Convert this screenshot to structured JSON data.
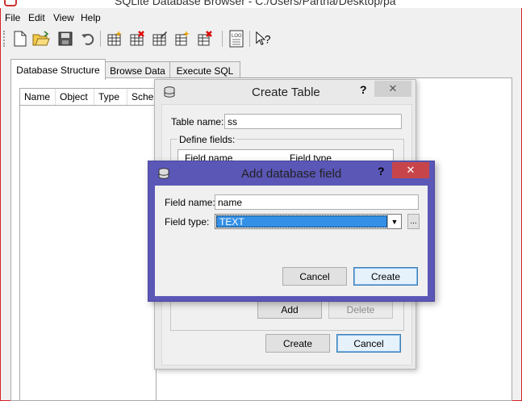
{
  "main_window": {
    "title": "SQLite Database Browser - C:/Users/Partha/Desktop/pa"
  },
  "menu": [
    "File",
    "Edit",
    "View",
    "Help"
  ],
  "toolbar": {
    "buttons": [
      "new-database-icon",
      "open-database-icon",
      "save-icon",
      "undo-icon",
      "create-table-icon",
      "delete-table-icon",
      "modify-table-icon",
      "create-index-icon",
      "delete-index-icon",
      "log-icon",
      "whats-this-icon"
    ],
    "log_label": "LOG"
  },
  "tabs": [
    "Database Structure",
    "Browse Data",
    "Execute SQL"
  ],
  "active_tab": 0,
  "structure_columns": [
    "Name",
    "Object",
    "Type",
    "Schema"
  ],
  "create_table": {
    "title": "Create Table",
    "help": "?",
    "close": "✕",
    "table_name_label": "Table name:",
    "table_name_value": "ss",
    "define_fields_label": "Define fields:",
    "field_columns": [
      "Field name",
      "Field type"
    ],
    "add_button": "Add",
    "delete_button": "Delete",
    "create_button": "Create",
    "cancel_button": "Cancel"
  },
  "add_field": {
    "title": "Add database field",
    "help": "?",
    "close": "✕",
    "field_name_label": "Field name:",
    "field_name_value": "name",
    "field_type_label": "Field type:",
    "field_type_value": "TEXT",
    "browse_button": "...",
    "cancel_button": "Cancel",
    "create_button": "Create"
  },
  "colors": {
    "add_field_frame": "#5b57b7",
    "close_button": "#c7454a",
    "selection": "#3390e6",
    "main_border": "#d9232a"
  }
}
